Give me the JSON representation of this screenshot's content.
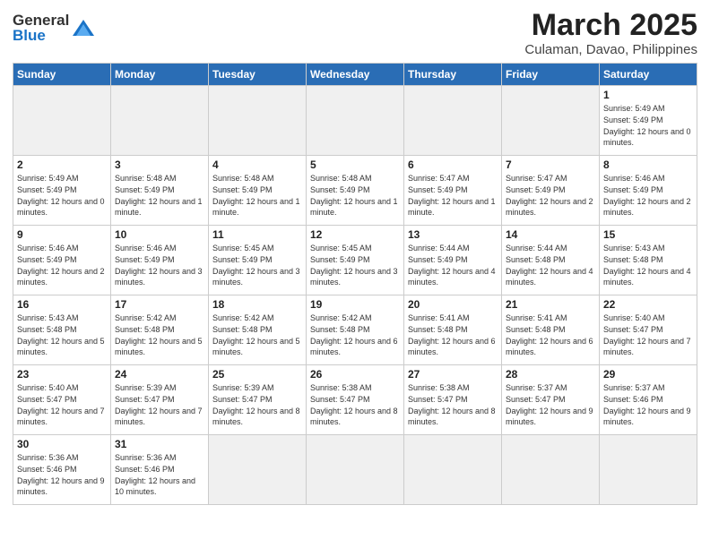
{
  "logo": {
    "text_general": "General",
    "text_blue": "Blue"
  },
  "header": {
    "month": "March 2025",
    "location": "Culaman, Davao, Philippines"
  },
  "weekdays": [
    "Sunday",
    "Monday",
    "Tuesday",
    "Wednesday",
    "Thursday",
    "Friday",
    "Saturday"
  ],
  "weeks": [
    [
      {
        "day": "",
        "empty": true
      },
      {
        "day": "",
        "empty": true
      },
      {
        "day": "",
        "empty": true
      },
      {
        "day": "",
        "empty": true
      },
      {
        "day": "",
        "empty": true
      },
      {
        "day": "",
        "empty": true
      },
      {
        "day": "1",
        "sunrise": "5:49 AM",
        "sunset": "5:49 PM",
        "daylight": "12 hours and 0 minutes."
      }
    ],
    [
      {
        "day": "2",
        "sunrise": "5:49 AM",
        "sunset": "5:49 PM",
        "daylight": "12 hours and 0 minutes."
      },
      {
        "day": "3",
        "sunrise": "5:48 AM",
        "sunset": "5:49 PM",
        "daylight": "12 hours and 1 minute."
      },
      {
        "day": "4",
        "sunrise": "5:48 AM",
        "sunset": "5:49 PM",
        "daylight": "12 hours and 1 minute."
      },
      {
        "day": "5",
        "sunrise": "5:48 AM",
        "sunset": "5:49 PM",
        "daylight": "12 hours and 1 minute."
      },
      {
        "day": "6",
        "sunrise": "5:47 AM",
        "sunset": "5:49 PM",
        "daylight": "12 hours and 1 minute."
      },
      {
        "day": "7",
        "sunrise": "5:47 AM",
        "sunset": "5:49 PM",
        "daylight": "12 hours and 2 minutes."
      },
      {
        "day": "8",
        "sunrise": "5:46 AM",
        "sunset": "5:49 PM",
        "daylight": "12 hours and 2 minutes."
      }
    ],
    [
      {
        "day": "9",
        "sunrise": "5:46 AM",
        "sunset": "5:49 PM",
        "daylight": "12 hours and 2 minutes."
      },
      {
        "day": "10",
        "sunrise": "5:46 AM",
        "sunset": "5:49 PM",
        "daylight": "12 hours and 3 minutes."
      },
      {
        "day": "11",
        "sunrise": "5:45 AM",
        "sunset": "5:49 PM",
        "daylight": "12 hours and 3 minutes."
      },
      {
        "day": "12",
        "sunrise": "5:45 AM",
        "sunset": "5:49 PM",
        "daylight": "12 hours and 3 minutes."
      },
      {
        "day": "13",
        "sunrise": "5:44 AM",
        "sunset": "5:49 PM",
        "daylight": "12 hours and 4 minutes."
      },
      {
        "day": "14",
        "sunrise": "5:44 AM",
        "sunset": "5:48 PM",
        "daylight": "12 hours and 4 minutes."
      },
      {
        "day": "15",
        "sunrise": "5:43 AM",
        "sunset": "5:48 PM",
        "daylight": "12 hours and 4 minutes."
      }
    ],
    [
      {
        "day": "16",
        "sunrise": "5:43 AM",
        "sunset": "5:48 PM",
        "daylight": "12 hours and 5 minutes."
      },
      {
        "day": "17",
        "sunrise": "5:42 AM",
        "sunset": "5:48 PM",
        "daylight": "12 hours and 5 minutes."
      },
      {
        "day": "18",
        "sunrise": "5:42 AM",
        "sunset": "5:48 PM",
        "daylight": "12 hours and 5 minutes."
      },
      {
        "day": "19",
        "sunrise": "5:42 AM",
        "sunset": "5:48 PM",
        "daylight": "12 hours and 6 minutes."
      },
      {
        "day": "20",
        "sunrise": "5:41 AM",
        "sunset": "5:48 PM",
        "daylight": "12 hours and 6 minutes."
      },
      {
        "day": "21",
        "sunrise": "5:41 AM",
        "sunset": "5:48 PM",
        "daylight": "12 hours and 6 minutes."
      },
      {
        "day": "22",
        "sunrise": "5:40 AM",
        "sunset": "5:47 PM",
        "daylight": "12 hours and 7 minutes."
      }
    ],
    [
      {
        "day": "23",
        "sunrise": "5:40 AM",
        "sunset": "5:47 PM",
        "daylight": "12 hours and 7 minutes."
      },
      {
        "day": "24",
        "sunrise": "5:39 AM",
        "sunset": "5:47 PM",
        "daylight": "12 hours and 7 minutes."
      },
      {
        "day": "25",
        "sunrise": "5:39 AM",
        "sunset": "5:47 PM",
        "daylight": "12 hours and 8 minutes."
      },
      {
        "day": "26",
        "sunrise": "5:38 AM",
        "sunset": "5:47 PM",
        "daylight": "12 hours and 8 minutes."
      },
      {
        "day": "27",
        "sunrise": "5:38 AM",
        "sunset": "5:47 PM",
        "daylight": "12 hours and 8 minutes."
      },
      {
        "day": "28",
        "sunrise": "5:37 AM",
        "sunset": "5:47 PM",
        "daylight": "12 hours and 9 minutes."
      },
      {
        "day": "29",
        "sunrise": "5:37 AM",
        "sunset": "5:46 PM",
        "daylight": "12 hours and 9 minutes."
      }
    ],
    [
      {
        "day": "30",
        "sunrise": "5:36 AM",
        "sunset": "5:46 PM",
        "daylight": "12 hours and 9 minutes."
      },
      {
        "day": "31",
        "sunrise": "5:36 AM",
        "sunset": "5:46 PM",
        "daylight": "12 hours and 10 minutes."
      },
      {
        "day": "",
        "empty": true
      },
      {
        "day": "",
        "empty": true
      },
      {
        "day": "",
        "empty": true
      },
      {
        "day": "",
        "empty": true
      },
      {
        "day": "",
        "empty": true
      }
    ]
  ]
}
